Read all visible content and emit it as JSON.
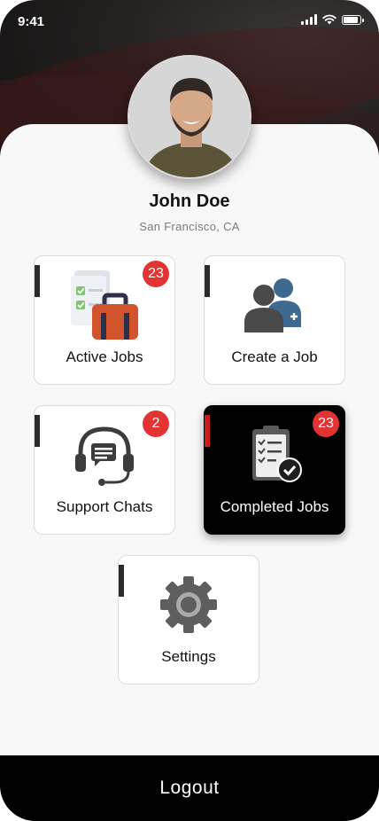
{
  "status_bar": {
    "time": "9:41"
  },
  "profile": {
    "name": "John Doe",
    "location": "San Francisco, CA"
  },
  "tiles": [
    {
      "label": "Active Jobs",
      "badge": "23",
      "icon": "briefcase-clipboard-icon"
    },
    {
      "label": "Create a Job",
      "icon": "add-user-icon"
    },
    {
      "label": "Support Chats",
      "badge": "2",
      "icon": "headset-chat-icon"
    },
    {
      "label": "Completed Jobs",
      "badge": "23",
      "icon": "checklist-clipboard-icon"
    },
    {
      "label": "Settings",
      "icon": "gear-icon"
    }
  ],
  "logout": {
    "label": "Logout"
  },
  "colors": {
    "badge": "#e43333",
    "accent": "#2b2b2b",
    "selected_accent": "#c91c1c",
    "selected_bg": "#000000"
  }
}
